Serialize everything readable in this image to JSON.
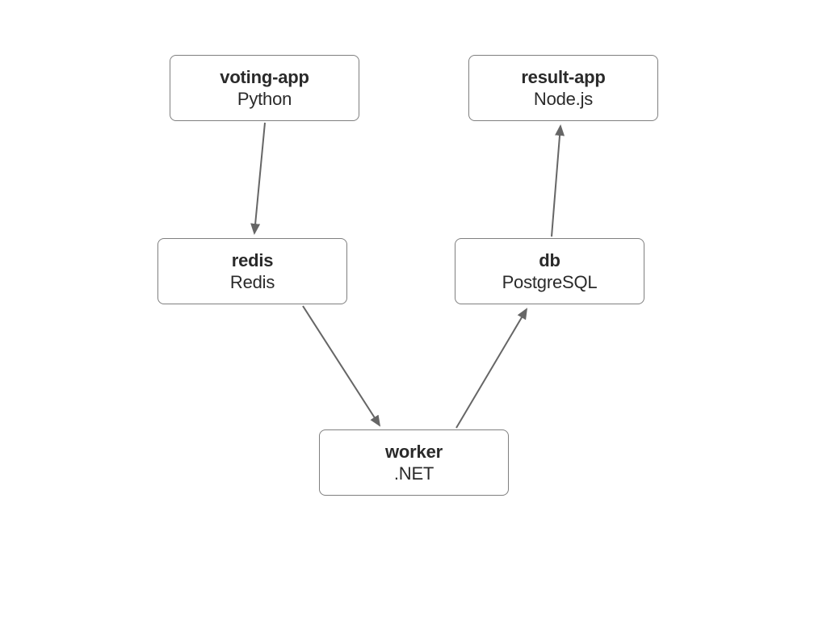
{
  "nodes": {
    "voting": {
      "title": "voting-app",
      "subtitle": "Python"
    },
    "result": {
      "title": "result-app",
      "subtitle": "Node.js"
    },
    "redis": {
      "title": "redis",
      "subtitle": "Redis"
    },
    "db": {
      "title": "db",
      "subtitle": "PostgreSQL"
    },
    "worker": {
      "title": "worker",
      "subtitle": ".NET"
    }
  },
  "arrows": [
    {
      "from": "voting",
      "to": "redis"
    },
    {
      "from": "redis",
      "to": "worker"
    },
    {
      "from": "worker",
      "to": "db"
    },
    {
      "from": "db",
      "to": "result"
    }
  ],
  "colors": {
    "arrow": "#666666",
    "border": "#7f7f7f"
  }
}
